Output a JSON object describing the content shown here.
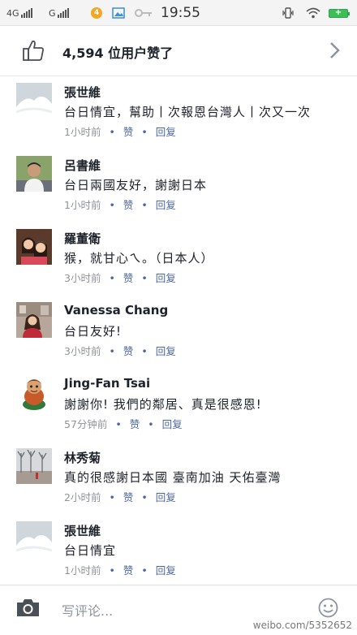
{
  "status_bar": {
    "network1": "4G",
    "network2": "G",
    "notification_count": "4",
    "time": "19:55",
    "battery_label": "+"
  },
  "likes": {
    "count_text": "4,594 位用户赞了"
  },
  "comments": [
    {
      "name": "張世維",
      "text": "台日情宜，幫助丨次報恩台灣人丨次又一次",
      "time": "1小时前",
      "like": "赞",
      "reply": "回复",
      "avatar": "snowy-landscape-avatar"
    },
    {
      "name": "呂書維",
      "text": "台日兩國友好，謝謝日本",
      "time": "1小时前",
      "like": "赞",
      "reply": "回复",
      "avatar": "man-outdoors-avatar"
    },
    {
      "name": "羅董衛",
      "text": "猴，就甘心ㄟ。（日本人）",
      "time": "3小时前",
      "like": "赞",
      "reply": "回复",
      "avatar": "girls-selfie-avatar"
    },
    {
      "name": "Vanessa Chang",
      "text": "台日友好!",
      "time": "3小时前",
      "like": "赞",
      "reply": "回复",
      "avatar": "woman-street-avatar"
    },
    {
      "name": "Jing-Fan Tsai",
      "text": "謝謝你! 我們的鄰居、真是很感恩!",
      "time": "57分钟前",
      "like": "赞",
      "reply": "回复",
      "avatar": "figurine-avatar"
    },
    {
      "name": "林秀菊",
      "text": "真的很感謝日本國 臺南加油 天佑臺灣",
      "time": "2小时前",
      "like": "赞",
      "reply": "回复",
      "avatar": "winter-trees-avatar"
    },
    {
      "name": "張世維",
      "text": "台日情宜",
      "time": "1小时前",
      "like": "赞",
      "reply": "回复",
      "avatar": "snowy-landscape-avatar"
    }
  ],
  "composer": {
    "placeholder": "写评论...",
    "watermark": "weibo.com/5352652"
  },
  "colors": {
    "link_blue": "#4b67a1",
    "meta_gray": "#90949c",
    "text": "#1d2129",
    "divider": "#e5e6e9"
  }
}
